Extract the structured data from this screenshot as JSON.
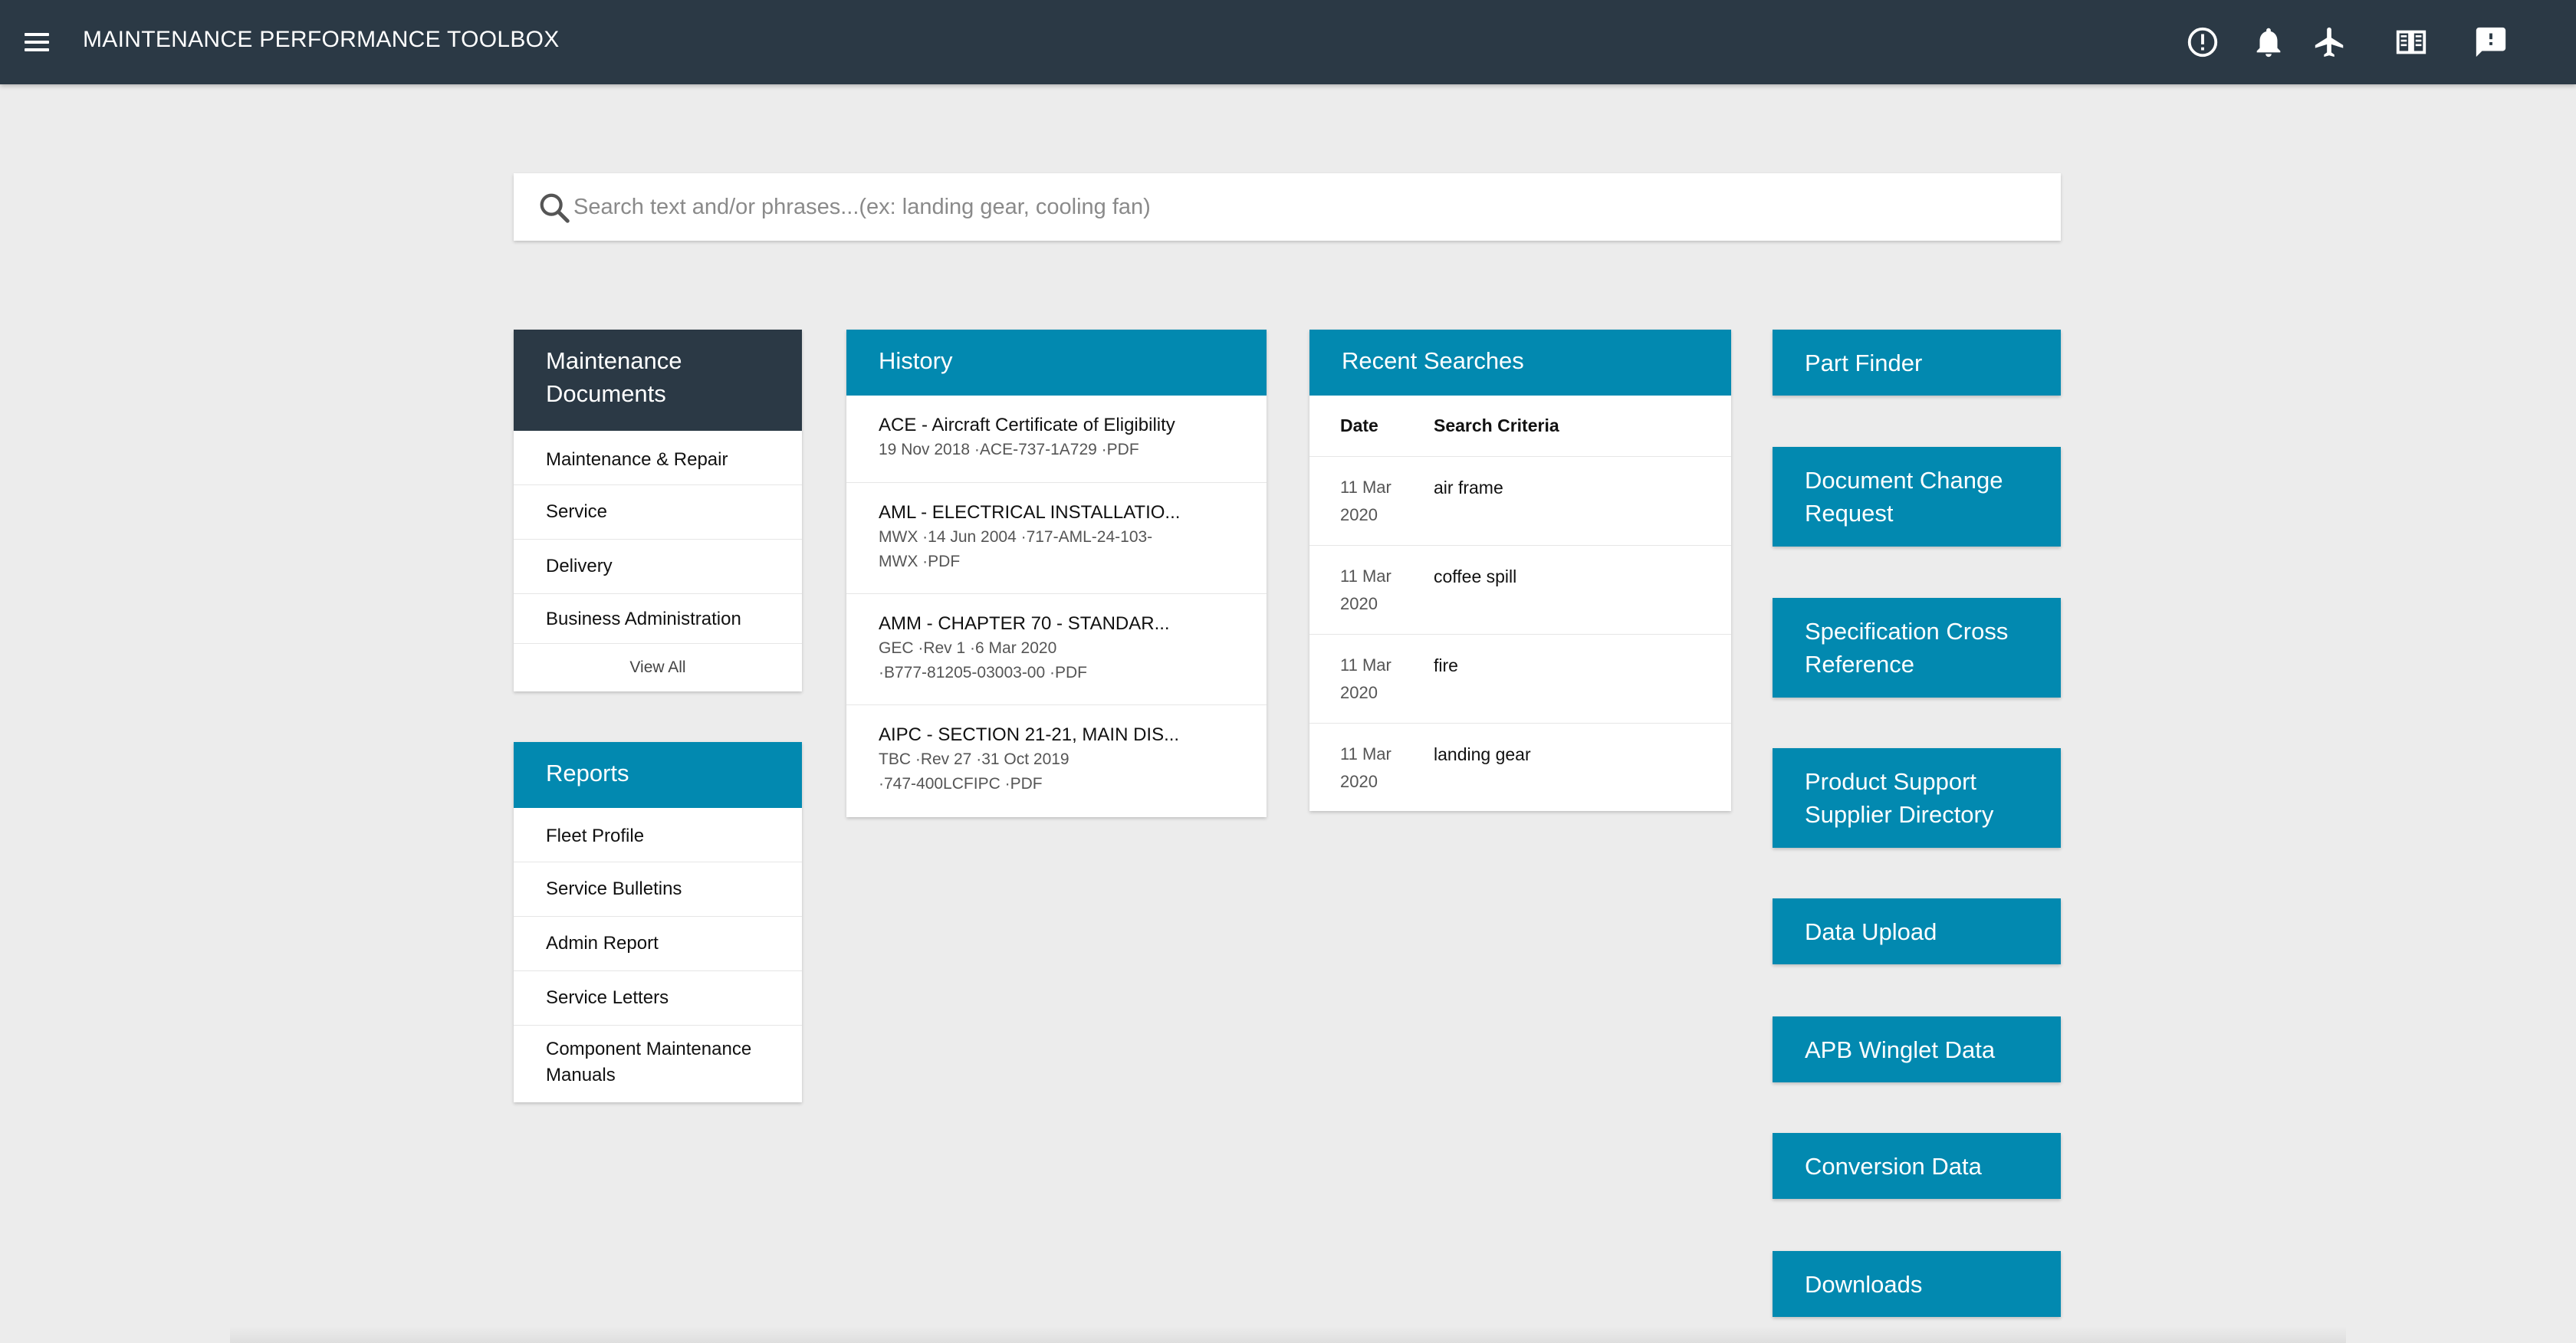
{
  "header": {
    "title": "MAINTENANCE PERFORMANCE TOOLBOX",
    "icons": [
      "menu-icon",
      "alert-circle-icon",
      "bell-icon",
      "airplane-icon",
      "book-icon",
      "feedback-icon"
    ]
  },
  "search": {
    "placeholder": "Search text and/or phrases...(ex: landing gear, cooling fan)"
  },
  "maintenance_documents": {
    "title_line1": "Maintenance",
    "title_line2": "Documents",
    "items": [
      "Maintenance & Repair",
      "Service",
      "Delivery",
      "Business Administration"
    ],
    "view_all": "View All"
  },
  "reports": {
    "title": "Reports",
    "items": [
      "Fleet Profile",
      "Service Bulletins",
      "Admin Report",
      "Service Letters",
      "Component Maintenance Manuals"
    ]
  },
  "history": {
    "title": "History",
    "items": [
      {
        "title": "ACE - Aircraft Certificate of Eligibility",
        "meta1": "19 Nov 2018 ·ACE-737-1A729 ·PDF",
        "meta2": ""
      },
      {
        "title": "AML - ELECTRICAL INSTALLATIO...",
        "meta1": "MWX ·14 Jun 2004 ·717-AML-24-103-",
        "meta2": "MWX ·PDF"
      },
      {
        "title": "AMM - CHAPTER 70 - STANDAR...",
        "meta1": "GEC ·Rev 1 ·6 Mar 2020",
        "meta2": "·B777-81205-03003-00 ·PDF"
      },
      {
        "title": "AIPC - SECTION 21-21, MAIN DIS...",
        "meta1": "TBC ·Rev 27 ·31 Oct 2019",
        "meta2": "·747-400LCFIPC ·PDF"
      }
    ]
  },
  "recent_searches": {
    "title": "Recent Searches",
    "col_date": "Date",
    "col_criteria": "Search Criteria",
    "rows": [
      {
        "date1": "11 Mar",
        "date2": "2020",
        "criteria": "air frame"
      },
      {
        "date1": "11 Mar",
        "date2": "2020",
        "criteria": "coffee spill"
      },
      {
        "date1": "11 Mar",
        "date2": "2020",
        "criteria": "fire"
      },
      {
        "date1": "11 Mar",
        "date2": "2020",
        "criteria": "landing gear"
      }
    ]
  },
  "actions": [
    {
      "line1": "Part Finder",
      "line2": ""
    },
    {
      "line1": "Document Change",
      "line2": "Request"
    },
    {
      "line1": "Specification Cross",
      "line2": "Reference"
    },
    {
      "line1": "Product Support",
      "line2": "Supplier Directory"
    },
    {
      "line1": "Data Upload",
      "line2": ""
    },
    {
      "line1": "APB Winglet Data",
      "line2": ""
    },
    {
      "line1": "Conversion Data",
      "line2": ""
    },
    {
      "line1": "Downloads",
      "line2": ""
    }
  ],
  "colors": {
    "header_bg": "#2b3945",
    "accent": "#0289b0",
    "page_bg": "#ececec"
  }
}
